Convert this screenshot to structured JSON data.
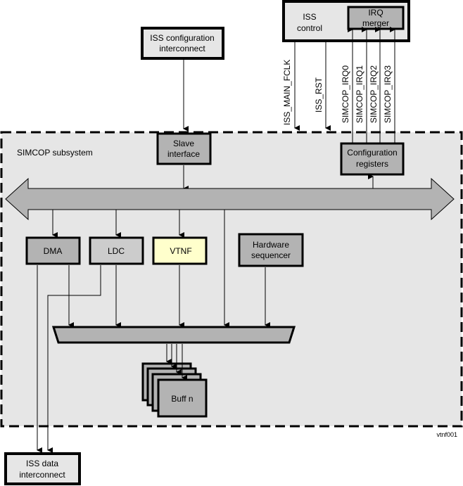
{
  "diagram": {
    "subsystem_label": "SIMCOP subsystem",
    "figure_id": "vtnf001",
    "blocks": {
      "iss_config_interconnect": [
        "ISS configuration",
        "interconnect"
      ],
      "iss_control": [
        "ISS",
        "control"
      ],
      "irq_merger": [
        "IRQ",
        "merger"
      ],
      "slave_interface": [
        "Slave",
        "interface"
      ],
      "config_registers": [
        "Configuration",
        "registers"
      ],
      "dma": [
        "DMA"
      ],
      "ldc": [
        "LDC"
      ],
      "vtnf": [
        "VTNF"
      ],
      "hw_sequencer": [
        "Hardware",
        "sequencer"
      ],
      "buff_n": [
        "Buff n"
      ],
      "iss_data_interconnect": [
        "ISS data",
        "interconnect"
      ]
    },
    "signals": [
      "ISS_MAIN_FCLK",
      "ISS_RST",
      "SIMCOP_IRQ0",
      "SIMCOP_IRQ1",
      "SIMCOP_IRQ2",
      "SIMCOP_IRQ3"
    ],
    "colors": {
      "subsystem_bg": "#e6e6e6",
      "block_light": "#e6e6e6",
      "block_mid": "#cccccc",
      "block_dark": "#b3b3b3",
      "vtnf_highlight": "#ffffcc",
      "bus_fill": "#b3b3b3"
    }
  }
}
